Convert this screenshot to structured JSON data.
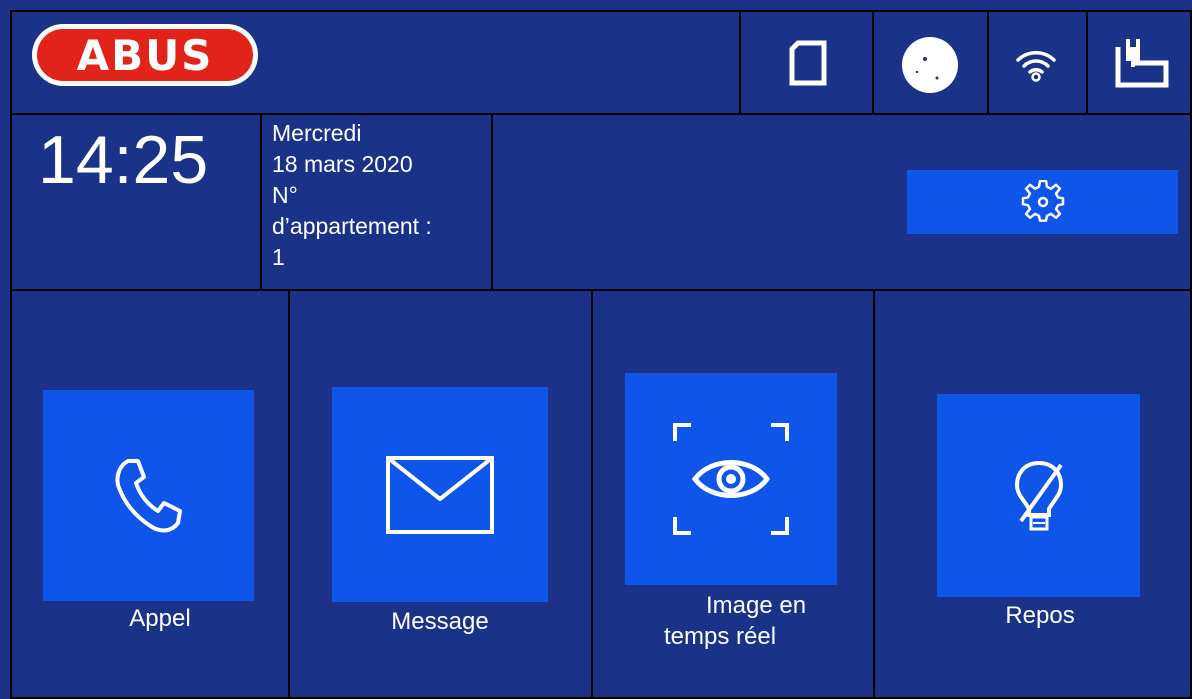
{
  "header": {
    "brand": "ABUS",
    "status_icons": [
      "sd-card-icon",
      "moon-icon",
      "wifi-icon",
      "power-plug-icon"
    ]
  },
  "info": {
    "time": "14:25",
    "weekday": "Mercredi",
    "date": "18 mars 2020",
    "apartment_line1": "N°",
    "apartment_line2": "d’appartement :",
    "apartment_number": "1",
    "settings_icon": "gear-icon"
  },
  "tiles": [
    {
      "label": "Appel",
      "icon": "phone-icon"
    },
    {
      "label": "Message",
      "icon": "envelope-icon"
    },
    {
      "label_line1": "Image en",
      "label_line2": "temps réel",
      "icon": "eye-scan-icon"
    },
    {
      "label": "Repos",
      "icon": "bulb-off-icon"
    }
  ],
  "colors": {
    "background": "#1a3389",
    "tile": "#0f55ea",
    "logo_red": "#e2231a",
    "border": "#000000",
    "text": "#ffffff"
  }
}
